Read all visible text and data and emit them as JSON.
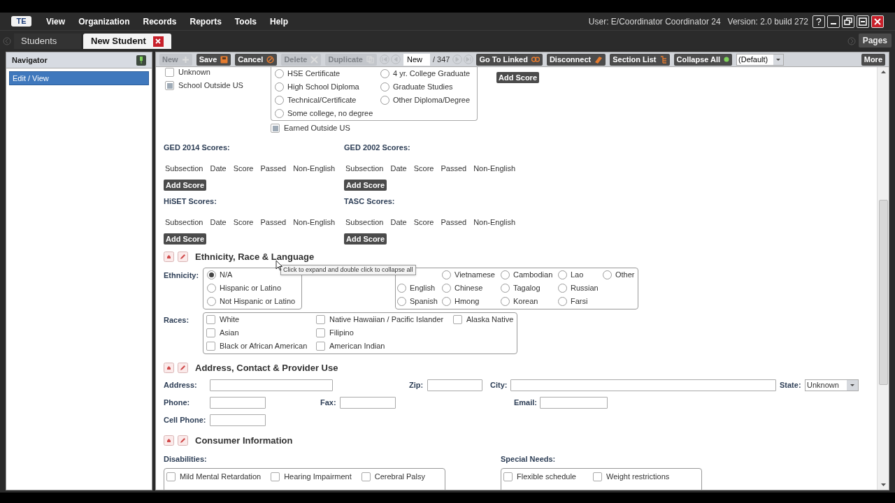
{
  "menu": {
    "logo": "TE",
    "items": [
      "View",
      "Organization",
      "Records",
      "Reports",
      "Tools",
      "Help"
    ],
    "user": "User: E/Coordinator Coordinator 24",
    "version": "Version: 2.0 build 272",
    "help": "?"
  },
  "tabs": [
    {
      "label": "Students",
      "selected": false
    },
    {
      "label": "New Student",
      "selected": true
    }
  ],
  "pages_button": "Pages",
  "navigator": {
    "title": "Navigator",
    "items": [
      {
        "label": "Edit / View",
        "selected": true
      }
    ]
  },
  "toolbar": [
    {
      "kind": "button",
      "label": "New",
      "disabled": true
    },
    {
      "kind": "button",
      "label": "Save",
      "disabled": false
    },
    {
      "kind": "button",
      "label": "Cancel",
      "disabled": false
    },
    {
      "kind": "button",
      "label": "Delete",
      "disabled": true
    },
    {
      "kind": "button",
      "label": "Duplicate",
      "disabled": true
    },
    {
      "kind": "nav",
      "disabled": true
    },
    {
      "kind": "nav",
      "disabled": true
    },
    {
      "kind": "record",
      "value": "New"
    },
    {
      "kind": "count",
      "label": "/ 347"
    },
    {
      "kind": "nav",
      "disabled": true
    },
    {
      "kind": "nav",
      "disabled": true
    },
    {
      "kind": "button",
      "label": "Go To Linked",
      "disabled": false
    },
    {
      "kind": "button",
      "label": "Disconnect",
      "disabled": false
    },
    {
      "kind": "button",
      "label": "Section List",
      "disabled": false
    },
    {
      "kind": "button",
      "label": "Collapse All",
      "disabled": false
    },
    {
      "kind": "select",
      "value": "(Default)"
    },
    {
      "kind": "button",
      "label": "More",
      "disabled": false
    }
  ],
  "school": {
    "checks": [
      {
        "label": "Unknown",
        "checked": false
      },
      {
        "label": "School Outside US",
        "checked": true
      }
    ],
    "degrees": [
      {
        "label": "HSE Certificate",
        "selected": false
      },
      {
        "label": "4 yr. College Graduate",
        "selected": false
      },
      {
        "label": "High School Diploma",
        "selected": false
      },
      {
        "label": "Graduate Studies",
        "selected": false
      },
      {
        "label": "Technical/Certificate",
        "selected": false
      },
      {
        "label": "Other Diploma/Degree",
        "selected": false
      },
      {
        "label": "Some college, no degree",
        "selected": false
      }
    ],
    "earned_outside": {
      "label": "Earned Outside US",
      "checked": true
    },
    "add_score": "Add Score"
  },
  "scores": [
    {
      "title": "GED 2014 Scores:",
      "columns": [
        "Subsection",
        "Date",
        "Score",
        "Passed",
        "Non-English"
      ],
      "button": "Add Score"
    },
    {
      "title": "GED 2002 Scores:",
      "columns": [
        "Subsection",
        "Date",
        "Score",
        "Passed",
        "Non-English"
      ],
      "button": "Add Score"
    },
    {
      "title": "HiSET Scores:",
      "columns": [
        "Subsection",
        "Date",
        "Score",
        "Passed",
        "Non-English"
      ],
      "button": "Add Score"
    },
    {
      "title": "TASC Scores:",
      "columns": [
        "Subsection",
        "Date",
        "Score",
        "Passed",
        "Non-English"
      ],
      "button": "Add Score"
    }
  ],
  "ethnicity_section": {
    "title": "Ethnicity, Race & Language",
    "tooltip": "Click  to expand and double click to collapse all",
    "ethnicity_label": "Ethnicity:",
    "ethnicity": [
      {
        "label": "N/A",
        "selected": true
      },
      {
        "label": "Hispanic or Latino",
        "selected": false
      },
      {
        "label": "Not Hispanic or Latino",
        "selected": false
      }
    ],
    "languages": [
      {
        "label": "Vietnamese",
        "selected": false
      },
      {
        "label": "Cambodian",
        "selected": false
      },
      {
        "label": "Lao",
        "selected": false
      },
      {
        "label": "Other",
        "selected": false
      },
      {
        "label": "English",
        "selected": false
      },
      {
        "label": "Chinese",
        "selected": false
      },
      {
        "label": "Tagalog",
        "selected": false
      },
      {
        "label": "Russian",
        "selected": false
      },
      {
        "label": "Spanish",
        "selected": false
      },
      {
        "label": "Hmong",
        "selected": false
      },
      {
        "label": "Korean",
        "selected": false
      },
      {
        "label": "Farsi",
        "selected": false
      }
    ],
    "races_label": "Races:",
    "races": [
      {
        "label": "White",
        "checked": false
      },
      {
        "label": "Native Hawaiian / Pacific Islander",
        "checked": false
      },
      {
        "label": "Alaska Native",
        "checked": false
      },
      {
        "label": "Asian",
        "checked": false
      },
      {
        "label": "Filipino",
        "checked": false
      },
      {
        "label": "Black or African American",
        "checked": false
      },
      {
        "label": "American Indian",
        "checked": false
      }
    ]
  },
  "address_section": {
    "title": "Address, Contact & Provider Use",
    "fields": [
      {
        "label": "Address:"
      },
      {
        "label": "Zip:"
      },
      {
        "label": "City:"
      },
      {
        "label": "State:",
        "kind": "select",
        "value": "Unknown"
      },
      {
        "label": "Phone:"
      },
      {
        "label": "Fax:"
      },
      {
        "label": "Email:"
      },
      {
        "label": "Cell Phone:"
      }
    ]
  },
  "consumer_section": {
    "title": "Consumer Information",
    "disabilities_label": "Disabilities:",
    "disabilities": [
      {
        "label": "Mild Mental Retardation",
        "checked": false
      },
      {
        "label": "Hearing Impairment",
        "checked": false
      },
      {
        "label": "Cerebral Palsy",
        "checked": false
      }
    ],
    "special_needs_label": "Special Needs:",
    "special_needs": [
      {
        "label": "Flexible schedule",
        "checked": false
      },
      {
        "label": "Weight restrictions",
        "checked": false
      }
    ]
  }
}
